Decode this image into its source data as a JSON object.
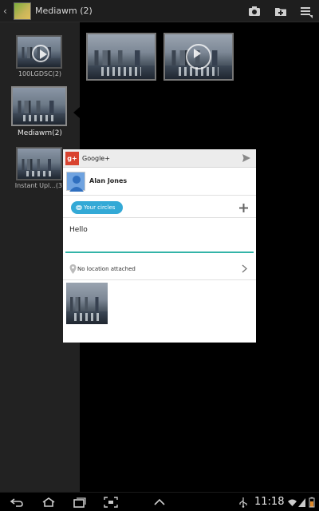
{
  "action_bar": {
    "title": "Mediawm (2)",
    "icons": [
      "back-icon",
      "camera-icon",
      "add-album-icon",
      "menu-icon"
    ]
  },
  "albums": [
    {
      "label": "100LGDSC(2)",
      "is_video": true,
      "selected": false
    },
    {
      "label": "Mediawm(2)",
      "is_video": false,
      "selected": true
    },
    {
      "label": "Instant Upl...(3)",
      "is_video": false,
      "selected": false
    }
  ],
  "grid": [
    {
      "type": "photo"
    },
    {
      "type": "video"
    }
  ],
  "share_dialog": {
    "title": "Google+",
    "logo_text": "g+",
    "user_name": "Alan Jones",
    "circles_label": "Your circles",
    "message": "Hello",
    "location": "No location attached",
    "accent_color": "#33b4a8",
    "chip_color": "#33a9d6",
    "logo_color": "#d9432f"
  },
  "status": {
    "time": "11:18",
    "icons": [
      "usb-icon",
      "wifi-icon",
      "signal-icon",
      "battery-icon"
    ]
  },
  "navbar": {
    "icons": [
      "back-nav-icon",
      "home-icon",
      "recent-apps-icon",
      "screenshot-icon",
      "up-arrow-icon"
    ]
  }
}
